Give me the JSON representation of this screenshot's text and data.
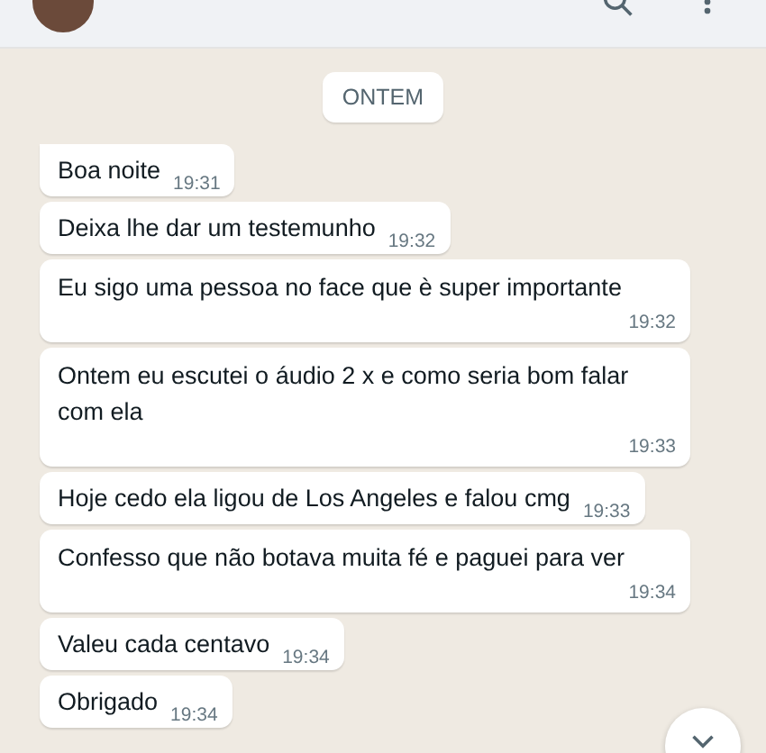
{
  "date_chip": "ONTEM",
  "messages": [
    {
      "kind": "inline",
      "text": "Boa noite",
      "time": "19:31",
      "tail": true
    },
    {
      "kind": "inline",
      "text": "Deixa lhe dar um testemunho",
      "time": "19:32",
      "tail": false
    },
    {
      "kind": "stacked",
      "text": "Eu sigo uma pessoa no face que è super importante",
      "time": "19:32",
      "tail": false
    },
    {
      "kind": "stacked",
      "text": "Ontem eu escutei o áudio 2 x e como seria bom falar com ela",
      "time": "19:33",
      "tail": false
    },
    {
      "kind": "inline",
      "text": "Hoje cedo ela ligou de Los Angeles e falou cmg",
      "time": "19:33",
      "tail": false
    },
    {
      "kind": "stacked",
      "text": "Confesso que não botava muita fé e paguei para ver",
      "time": "19:34",
      "tail": false
    },
    {
      "kind": "inline",
      "text": "Valeu cada centavo",
      "time": "19:34",
      "tail": false
    },
    {
      "kind": "inline",
      "text": "Obrigado",
      "time": "19:34",
      "tail": false
    }
  ]
}
